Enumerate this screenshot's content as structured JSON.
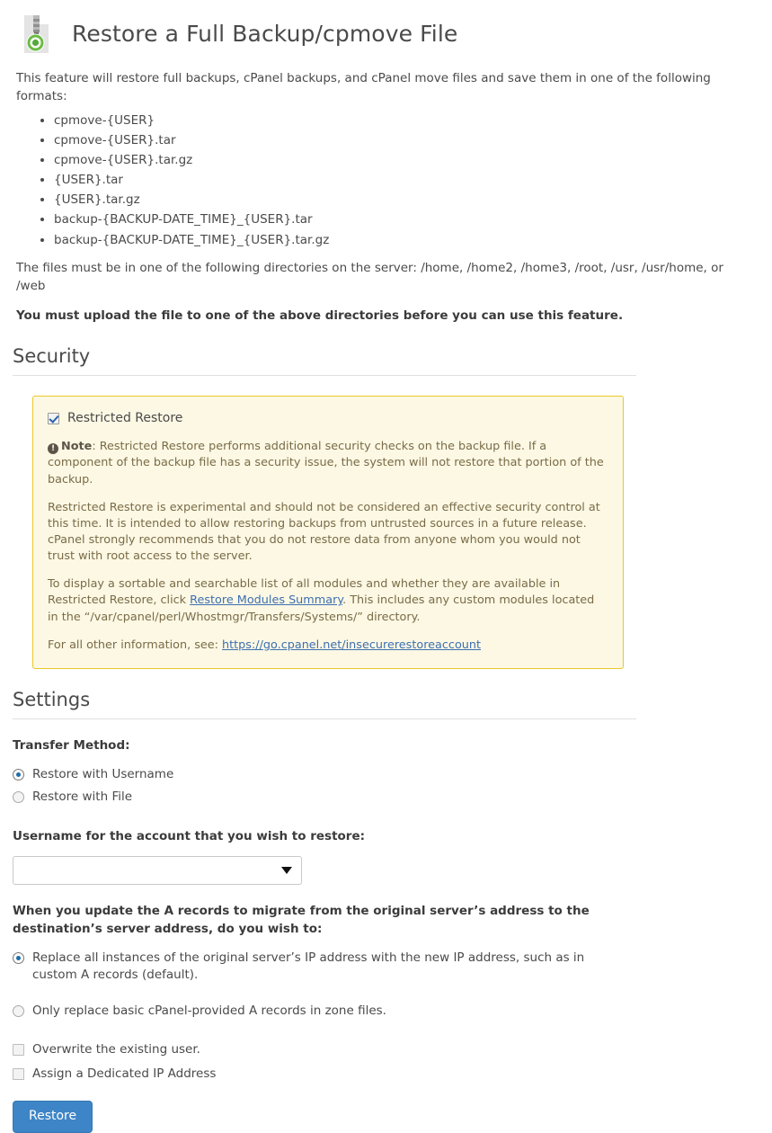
{
  "header": {
    "title": "Restore a Full Backup/cpmove File",
    "icon": "zip-file-restore-icon"
  },
  "intro": {
    "lead": "This feature will restore full backups, cPanel backups, and cPanel move files and save them in one of the following formats:",
    "formats": [
      "cpmove-{USER}",
      "cpmove-{USER}.tar",
      "cpmove-{USER}.tar.gz",
      "{USER}.tar",
      "{USER}.tar.gz",
      "backup-{BACKUP-DATE_TIME}_{USER}.tar",
      "backup-{BACKUP-DATE_TIME}_{USER}.tar.gz"
    ],
    "directories_line": "The files must be in one of the following directories on the server: /home, /home2, /home3, /root, /usr, /usr/home, or /web",
    "must_upload_line": "You must upload the file to one of the above directories before you can use this feature."
  },
  "security": {
    "heading": "Security",
    "restricted_restore_label": "Restricted Restore",
    "restricted_restore_checked": true,
    "note_prefix": "Note",
    "note_text": ": Restricted Restore performs additional security checks on the backup file. If a component of the backup file has a security issue, the system will not restore that portion of the backup.",
    "paragraph_experimental": "Restricted Restore is experimental and should not be considered an effective security control at this time. It is intended to allow restoring backups from untrusted sources in a future release. cPanel strongly recommends that you do not restore data from anyone whom you would not trust with root access to the server.",
    "modules_text_before": "To display a sortable and searchable list of all modules and whether they are available in Restricted Restore, click ",
    "modules_link": "Restore Modules Summary",
    "modules_text_after": ". This includes any custom modules located in the “/var/cpanel/perl/Whostmgr/Transfers/Systems/” directory.",
    "other_info_before": "For all other information, see: ",
    "other_info_link": "https://go.cpanel.net/insecurerestoreaccount",
    "colors": {
      "alert_background": "#fcf8e4",
      "alert_border": "#eac828",
      "link": "#3d6fb0"
    }
  },
  "settings": {
    "heading": "Settings",
    "transfer_method_label": "Transfer Method:",
    "transfer_methods": [
      {
        "label": "Restore with Username",
        "selected": true
      },
      {
        "label": "Restore with File",
        "selected": false
      }
    ],
    "username_label": "Username for the account that you wish to restore:",
    "username_value": "",
    "username_placeholder": "",
    "a_records_label": "When you update the A records to migrate from the original server’s address to the destination’s server address, do you wish to:",
    "a_records_options": [
      {
        "label": "Replace all instances of the original server’s IP address with the new IP address, such as in custom A records (default).",
        "selected": true
      },
      {
        "label": "Only replace basic cPanel-provided A records in zone files.",
        "selected": false
      }
    ],
    "checkboxes": [
      {
        "label": "Overwrite the existing user.",
        "checked": false
      },
      {
        "label": "Assign a Dedicated IP Address",
        "checked": false
      }
    ],
    "submit_label": "Restore",
    "colors": {
      "button": "#3d85c6"
    }
  }
}
